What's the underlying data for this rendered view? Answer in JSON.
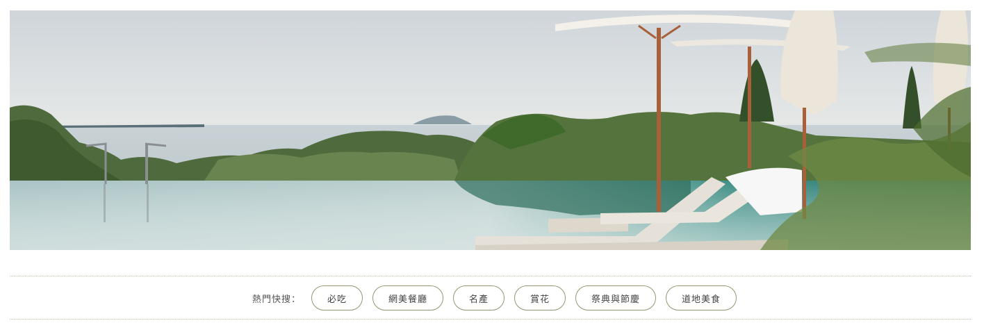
{
  "hero": {
    "image": "resort-infinity-pool-with-umbrellas-and-loungers"
  },
  "quick_search": {
    "label": "熱門快搜：",
    "tags": [
      "必吃",
      "網美餐廳",
      "名產",
      "賞花",
      "祭典與節慶",
      "道地美食"
    ]
  },
  "colors": {
    "tag_border": "#8c9a70",
    "divider": "#b9c7a1",
    "text": "#444444"
  }
}
